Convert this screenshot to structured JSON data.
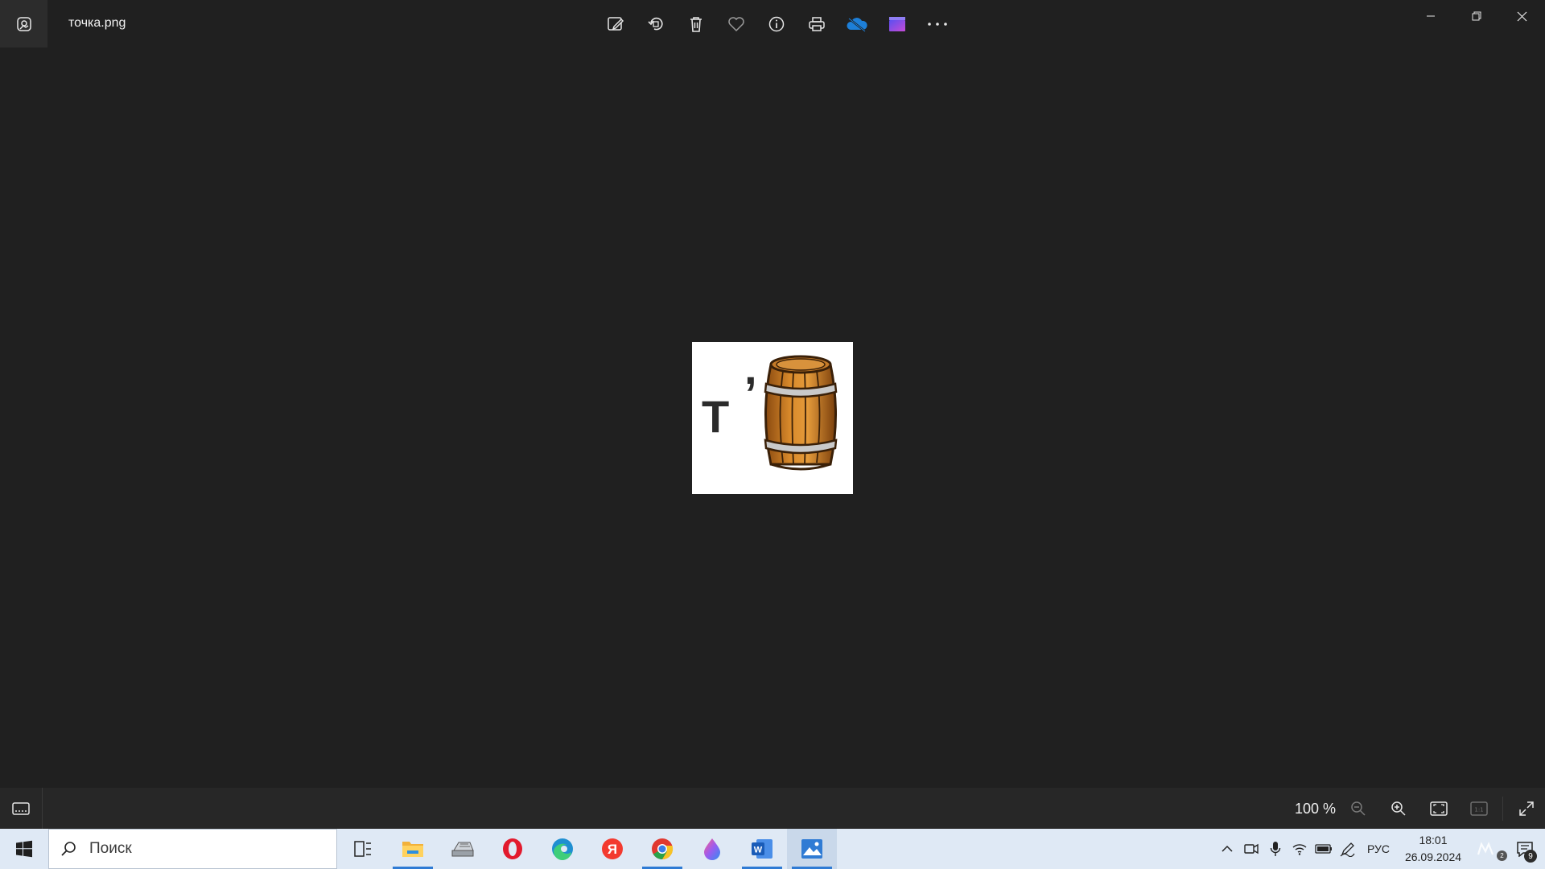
{
  "window": {
    "title": "точка.png"
  },
  "toolbar": {
    "buttons": [
      {
        "name": "edit-image-button",
        "icon": "edit-image-icon"
      },
      {
        "name": "rotate-button",
        "icon": "rotate-icon"
      },
      {
        "name": "delete-button",
        "icon": "trash-icon"
      },
      {
        "name": "favorite-button",
        "icon": "heart-icon"
      },
      {
        "name": "info-button",
        "icon": "info-icon"
      },
      {
        "name": "print-button",
        "icon": "printer-icon"
      },
      {
        "name": "onedrive-button",
        "icon": "cloud-icon"
      },
      {
        "name": "video-editor-button",
        "icon": "clapperboard-icon"
      },
      {
        "name": "more-button",
        "icon": "more-icon"
      }
    ]
  },
  "image": {
    "letter": "Т",
    "apostrophe": ","
  },
  "zoombar": {
    "zoom_level": "100 %"
  },
  "taskbar": {
    "search_placeholder": "Поиск",
    "apps": [
      {
        "name": "task-view",
        "icon": "task-view-icon",
        "running": false
      },
      {
        "name": "file-explorer",
        "icon": "folder-icon",
        "running": true
      },
      {
        "name": "scanner-app",
        "icon": "scanner-icon",
        "running": false
      },
      {
        "name": "opera",
        "icon": "opera-icon",
        "running": false
      },
      {
        "name": "edge",
        "icon": "edge-icon",
        "running": false
      },
      {
        "name": "yandex",
        "icon": "yandex-icon",
        "running": false
      },
      {
        "name": "chrome",
        "icon": "chrome-icon",
        "running": true
      },
      {
        "name": "paint-drop-app",
        "icon": "drop-icon",
        "running": false
      },
      {
        "name": "word",
        "icon": "word-icon",
        "running": true
      },
      {
        "name": "photos",
        "icon": "photos-icon",
        "running": true,
        "active": true
      }
    ],
    "tray": {
      "language": "РУС",
      "time": "18:01",
      "date": "26.09.2024",
      "notification_count": "9",
      "small_badge": "2"
    }
  },
  "colors": {
    "background": "#202020",
    "taskbar": "#dfe9f5",
    "accent": "#2f7bd4"
  }
}
